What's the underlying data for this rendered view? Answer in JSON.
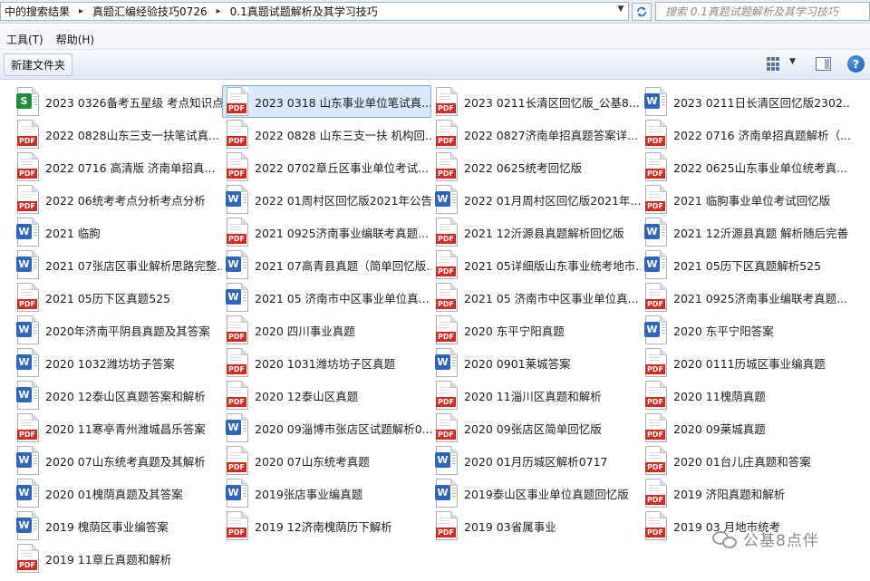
{
  "address": {
    "breadcrumbs": [
      "中的搜索结果",
      "真题汇编经验技巧0726",
      "0.1真题试题解析及其学习技巧"
    ],
    "search_placeholder": "搜索 0.1真题试题解析及其学习技巧"
  },
  "menu": {
    "items": [
      "工具(T)",
      "帮助(H)"
    ]
  },
  "toolbar": {
    "new_folder_label": "新建文件夹"
  },
  "colors": {
    "pdf": "#d22b20",
    "word": "#2f66bd",
    "sheet": "#1f8e3d",
    "selection": "#d9e9fb"
  },
  "files": [
    {
      "name": "2023 0326备考五星级 考点知识点",
      "type": "sheet"
    },
    {
      "name": "2023 0318  山东事业单位笔试真...",
      "type": "pdf",
      "selected": true
    },
    {
      "name": "2023 0211长清区回忆版_公基8...",
      "type": "pdf"
    },
    {
      "name": "2023 0211日长清区回忆版2302...",
      "type": "word"
    },
    {
      "name": "2022 0828山东三支一扶笔试真...",
      "type": "pdf"
    },
    {
      "name": "2022 0828 山东三支一扶 机构回...",
      "type": "pdf"
    },
    {
      "name": "2022 0827济南单招真题答案详...",
      "type": "pdf"
    },
    {
      "name": "2022 0716 济南单招真题解析（...",
      "type": "pdf"
    },
    {
      "name": "2022 0716 高清版  济南单招真...",
      "type": "pdf"
    },
    {
      "name": "2022 0702章丘区事业单位考试...",
      "type": "pdf"
    },
    {
      "name": "2022 0625统考回忆版",
      "type": "pdf"
    },
    {
      "name": "2022 0625山东事业单位统考真...",
      "type": "pdf"
    },
    {
      "name": "2022 06统考考点分析考点分析",
      "type": "pdf"
    },
    {
      "name": "2022 01周村区回忆版2021年公告",
      "type": "word"
    },
    {
      "name": "2022 01月周村区回忆版2021年...",
      "type": "word"
    },
    {
      "name": "2021 临朐事业单位考试回忆版",
      "type": "pdf"
    },
    {
      "name": "2021 临朐",
      "type": "word"
    },
    {
      "name": "2021 0925济南事业编联考真题...",
      "type": "pdf"
    },
    {
      "name": "2021 12沂源县真题解析回忆版",
      "type": "pdf"
    },
    {
      "name": "2021 12沂源县真题 解析随后完善",
      "type": "word"
    },
    {
      "name": "2021 07张店区事业解析思路完整...",
      "type": "word"
    },
    {
      "name": "2021 07高青县真题（简单回忆版...",
      "type": "word"
    },
    {
      "name": "2021 05详细版山东事业统考地市...",
      "type": "pdf"
    },
    {
      "name": "2021 05历下区真题解析525",
      "type": "word"
    },
    {
      "name": "2021 05历下区真题525",
      "type": "pdf"
    },
    {
      "name": "2021 05 济南市中区事业单位真...",
      "type": "word"
    },
    {
      "name": "2021 05 济南市中区事业单位真...",
      "type": "pdf"
    },
    {
      "name": "2021  0925济南事业编联考真题...",
      "type": "pdf"
    },
    {
      "name": "2020年济南平阴县真题及其答案",
      "type": "word"
    },
    {
      "name": "2020 四川事业真题",
      "type": "pdf"
    },
    {
      "name": "2020 东平宁阳真题",
      "type": "pdf"
    },
    {
      "name": "2020 东平宁阳答案",
      "type": "word"
    },
    {
      "name": "2020 1032潍坊坊子答案",
      "type": "word"
    },
    {
      "name": "2020 1031潍坊坊子区真题",
      "type": "pdf"
    },
    {
      "name": "2020 0901莱城答案",
      "type": "word"
    },
    {
      "name": "2020 0111历城区事业编真题",
      "type": "pdf"
    },
    {
      "name": "2020 12泰山区真题答案和解析",
      "type": "word"
    },
    {
      "name": "2020 12泰山区真题",
      "type": "pdf"
    },
    {
      "name": "2020 11淄川区真题和解析",
      "type": "pdf"
    },
    {
      "name": "2020 11槐荫真题",
      "type": "pdf"
    },
    {
      "name": "2020 11寒亭青州潍城昌乐答案",
      "type": "pdf"
    },
    {
      "name": "2020 09淄博市张店区试题解析0...",
      "type": "word"
    },
    {
      "name": "2020 09张店区简单回忆版",
      "type": "pdf"
    },
    {
      "name": "2020 09莱城真题",
      "type": "pdf"
    },
    {
      "name": "2020 07山东统考真题及其解析",
      "type": "word"
    },
    {
      "name": "2020 07山东统考真题",
      "type": "pdf"
    },
    {
      "name": "2020 01月历城区解析0717",
      "type": "word"
    },
    {
      "name": "2020 01台儿庄真题和答案",
      "type": "pdf"
    },
    {
      "name": "2020 01槐荫真题及其答案",
      "type": "word"
    },
    {
      "name": "2019张店事业编真题",
      "type": "word"
    },
    {
      "name": "2019泰山区事业单位真题回忆版",
      "type": "word"
    },
    {
      "name": "2019 济阳真题和解析",
      "type": "pdf"
    },
    {
      "name": "2019 槐荫区事业编答案",
      "type": "word"
    },
    {
      "name": "2019 12济南槐荫历下解析",
      "type": "pdf"
    },
    {
      "name": "2019 03省属事业",
      "type": "pdf"
    },
    {
      "name": "2019 03 月地市统考",
      "type": "pdf"
    },
    {
      "name": "2019  11章丘真题和解析",
      "type": "pdf"
    }
  ],
  "watermark": {
    "text": "公基8点伴",
    "icon": "chat-bubbles-icon"
  }
}
